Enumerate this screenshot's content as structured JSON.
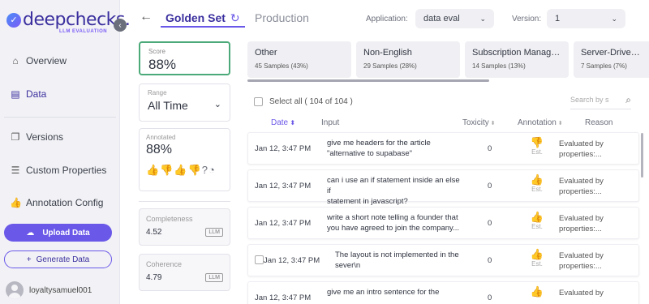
{
  "brand": {
    "logo_text": "deepchecks.",
    "logo_sub": "LLM EVALUATION"
  },
  "sidebar": {
    "collapse_glyph": "‹",
    "items": [
      {
        "label": "Overview",
        "icon": "home-icon"
      },
      {
        "label": "Data",
        "icon": "table-icon"
      },
      {
        "label": "Versions",
        "icon": "copy-icon"
      },
      {
        "label": "Custom Properties",
        "icon": "sliders-icon"
      },
      {
        "label": "Annotation Config",
        "icon": "thumbs-up-icon"
      }
    ],
    "upload_label": "Upload Data",
    "generate_label": "Generate Data",
    "username": "loyaltysamuel001"
  },
  "header": {
    "back_glyph": "←",
    "tab_golden": "Golden Set",
    "tab_production": "Production",
    "application_label": "Application:",
    "application_value": "data eval",
    "version_label": "Version:",
    "version_value": "1"
  },
  "stats": {
    "score_title": "Score",
    "score_value": "88%",
    "range_title": "Range",
    "range_value": "All Time",
    "annotated_title": "Annotated",
    "annotated_value": "88%",
    "properties": [
      {
        "name": "Completeness",
        "value": "4.52",
        "tag": "LLM"
      },
      {
        "name": "Coherence",
        "value": "4.79",
        "tag": "LLM"
      }
    ]
  },
  "categories": [
    {
      "name": "Other",
      "samples": "45 Samples (43%)"
    },
    {
      "name": "Non-English",
      "samples": "29 Samples (28%)"
    },
    {
      "name": "Subscription Manage…",
      "samples": "14 Samples (13%)"
    },
    {
      "name": "Server-Driven UI",
      "samples": "7 Samples (7%)"
    }
  ],
  "table": {
    "select_all": "Select all ( 104 of 104 )",
    "search_placeholder": "Search by s",
    "columns": {
      "date": "Date",
      "input": "Input",
      "toxicity": "Toxicity",
      "annotation": "Annotation",
      "reason": "Reason"
    },
    "rows": [
      {
        "date": "Jan 12, 3:47 PM",
        "input_l1": "give me headers for the article",
        "input_l2": "\"alternative to supabase\"",
        "toxicity": "0",
        "annotation": "bad",
        "est": "Est.",
        "reason_l1": "Evaluated by",
        "reason_l2": "properties:..."
      },
      {
        "date": "Jan 12, 3:47 PM",
        "input_l1": "can i use an if statement inside an else if",
        "input_l2": "statement in javascript?",
        "toxicity": "0",
        "annotation": "good",
        "est": "Est.",
        "reason_l1": "Evaluated by",
        "reason_l2": "properties:..."
      },
      {
        "date": "Jan 12, 3:47 PM",
        "input_l1": "write a short note telling a founder that",
        "input_l2": "you have agreed to join the company...",
        "toxicity": "0",
        "annotation": "good",
        "est": "Est.",
        "reason_l1": "Evaluated by",
        "reason_l2": "properties:..."
      },
      {
        "date": "Jan 12, 3:47 PM",
        "input_l1": "The layout is not implemented in the",
        "input_l2": "sever\\n",
        "toxicity": "0",
        "annotation": "good",
        "est": "Est.",
        "reason_l1": "Evaluated by",
        "reason_l2": "properties:..."
      },
      {
        "date": "Jan 12, 3:47 PM",
        "input_l1": "give me an intro sentence for the",
        "input_l2": "",
        "toxicity": "0",
        "annotation": "good",
        "est": "",
        "reason_l1": "Evaluated by",
        "reason_l2": ""
      }
    ]
  },
  "colors": {
    "accent": "#6a58e8",
    "brand": "#3a2f9e",
    "good": "#3aaa6a",
    "bad": "#e05555",
    "score_border": "#4caa7a"
  }
}
